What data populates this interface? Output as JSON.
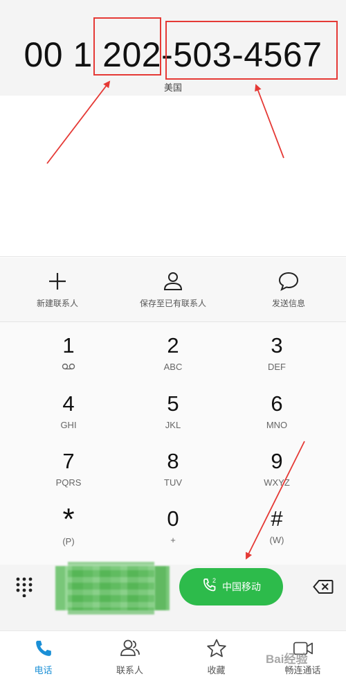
{
  "display": {
    "number": "00 1 202-503-4567",
    "region": "美国"
  },
  "actions": [
    {
      "label": "新建联系人",
      "icon": "plus-icon"
    },
    {
      "label": "保存至已有联系人",
      "icon": "person-icon"
    },
    {
      "label": "发送信息",
      "icon": "chat-bubble-icon"
    }
  ],
  "keypad": {
    "keys": [
      {
        "digit": "1",
        "letters": ""
      },
      {
        "digit": "2",
        "letters": "ABC"
      },
      {
        "digit": "3",
        "letters": "DEF"
      },
      {
        "digit": "4",
        "letters": "GHI"
      },
      {
        "digit": "5",
        "letters": "JKL"
      },
      {
        "digit": "6",
        "letters": "MNO"
      },
      {
        "digit": "7",
        "letters": "PQRS"
      },
      {
        "digit": "8",
        "letters": "TUV"
      },
      {
        "digit": "9",
        "letters": "WXYZ"
      },
      {
        "digit": "*",
        "letters": "(P)"
      },
      {
        "digit": "0",
        "letters": "+"
      },
      {
        "digit": "#",
        "letters": "(W)"
      }
    ]
  },
  "call": {
    "sim_slot": "2",
    "carrier_label": "中国移动",
    "button_color": "#2dbb4b"
  },
  "bottom_nav": [
    {
      "label": "电话",
      "icon": "phone-icon",
      "active": true
    },
    {
      "label": "联系人",
      "icon": "contacts-icon",
      "active": false
    },
    {
      "label": "收藏",
      "icon": "star-icon",
      "active": false
    },
    {
      "label": "畅连通话",
      "icon": "video-call-icon",
      "active": false
    }
  ],
  "watermark": "Bai经验",
  "colors": {
    "accent": "#1a8fd6",
    "annotation": "#e53935"
  }
}
